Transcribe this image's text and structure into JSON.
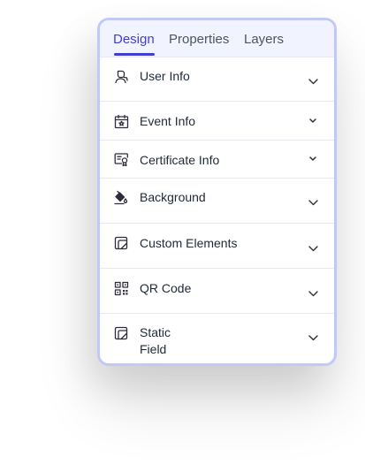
{
  "tabs": [
    {
      "label": "Design",
      "active": true
    },
    {
      "label": "Properties",
      "active": false
    },
    {
      "label": "Layers",
      "active": false
    }
  ],
  "sections": [
    {
      "label": "User Info",
      "icon": "user-info-icon"
    },
    {
      "label": "Event Info",
      "icon": "calendar-icon"
    },
    {
      "label": "Certificate Info",
      "icon": "certificate-icon"
    },
    {
      "label": "Background",
      "icon": "paint-bucket-icon"
    },
    {
      "label": "Custom Elements",
      "icon": "custom-element-icon"
    },
    {
      "label": "QR Code",
      "icon": "qr-code-icon"
    },
    {
      "label": "Static Field",
      "icon": "static-field-icon"
    }
  ],
  "colors": {
    "accent": "#3f3fcf",
    "panel_border": "#c3c9f7",
    "tab_bar_bg": "#f1f3fe",
    "text": "#1f2937",
    "muted_text": "#4b5563"
  }
}
